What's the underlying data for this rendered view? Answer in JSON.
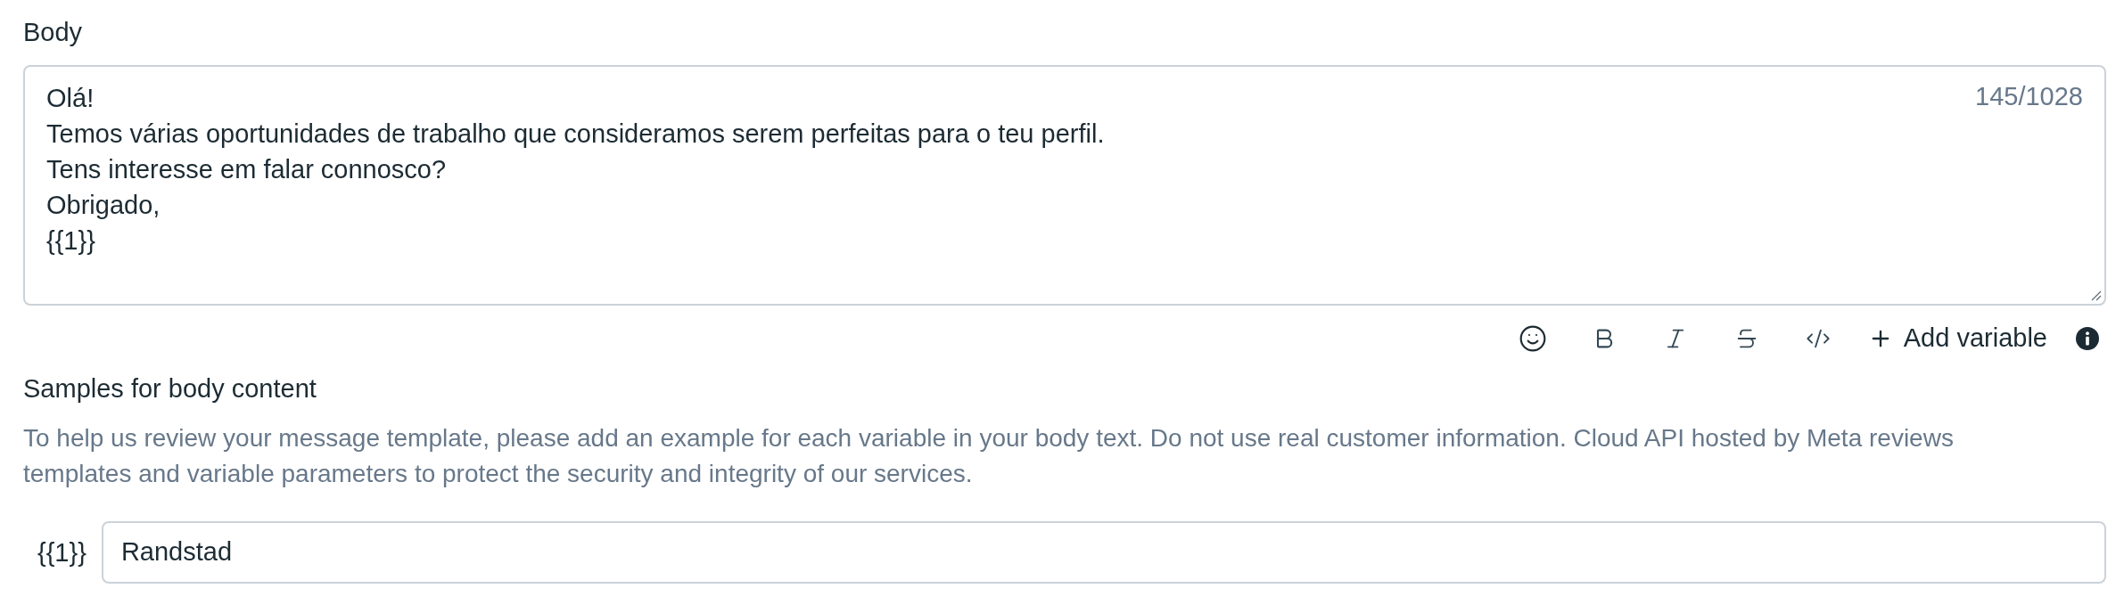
{
  "body": {
    "label": "Body",
    "value": "Olá!\nTemos várias oportunidades de trabalho que consideramos serem perfeitas para o teu perfil.\nTens interesse em falar connosco?\nObrigado,\n{{1}}",
    "counter": "145/1028"
  },
  "toolbar": {
    "add_variable": "Add variable"
  },
  "samples": {
    "title": "Samples for body content",
    "description": "To help us review your message template, please add an example for each variable in your body text. Do not use real customer information. Cloud API hosted by Meta reviews templates and variable parameters to protect the security and integrity of our services.",
    "variables": [
      {
        "label": "{{1}}",
        "value": "Randstad"
      }
    ]
  }
}
